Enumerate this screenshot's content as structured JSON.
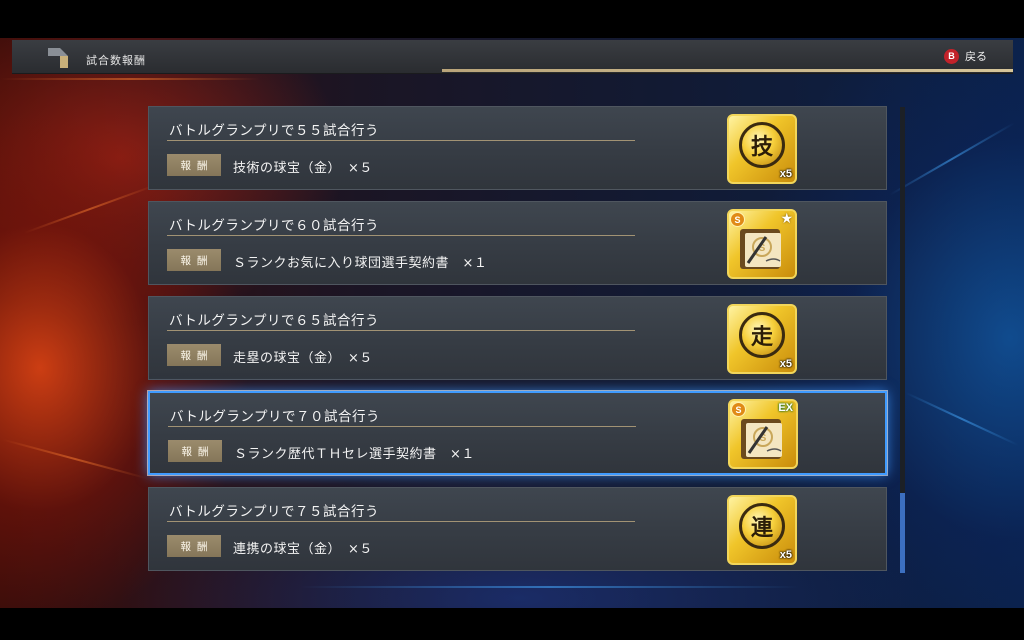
{
  "header": {
    "title": "試合数報酬",
    "back_button_key": "B",
    "back_label": "戻る"
  },
  "reward_tag_label": "報酬",
  "missions": [
    {
      "title": "バトルグランプリで５５試合行う",
      "reward": "技術の球宝（金）　×５",
      "icon": "skill-gem-icon",
      "icon_char": "技",
      "icon_qty": "x5",
      "selected": false
    },
    {
      "title": "バトルグランプリで６０試合行う",
      "reward": "Ｓランクお気に入り球団選手契約書　×１",
      "icon": "favorite-contract-icon",
      "selected": false
    },
    {
      "title": "バトルグランプリで６５試合行う",
      "reward": "走塁の球宝（金）　×５",
      "icon": "baserunning-gem-icon",
      "icon_char": "走",
      "icon_qty": "x5",
      "selected": false
    },
    {
      "title": "バトルグランプリで７０試合行う",
      "reward": "Ｓランク歴代ＴＨセレ選手契約書　×１",
      "icon": "ex-contract-icon",
      "icon_badge": "EX",
      "selected": true
    },
    {
      "title": "バトルグランプリで７５試合行う",
      "reward": "連携の球宝（金）　×５",
      "icon": "teamwork-gem-icon",
      "icon_char": "連",
      "icon_qty": "x5",
      "selected": false
    }
  ],
  "colors": {
    "accent_select": "#3f9bff",
    "underline": "#b5a27c",
    "reward_tag": "#9b8b6c",
    "back_key": "#c2222a"
  }
}
